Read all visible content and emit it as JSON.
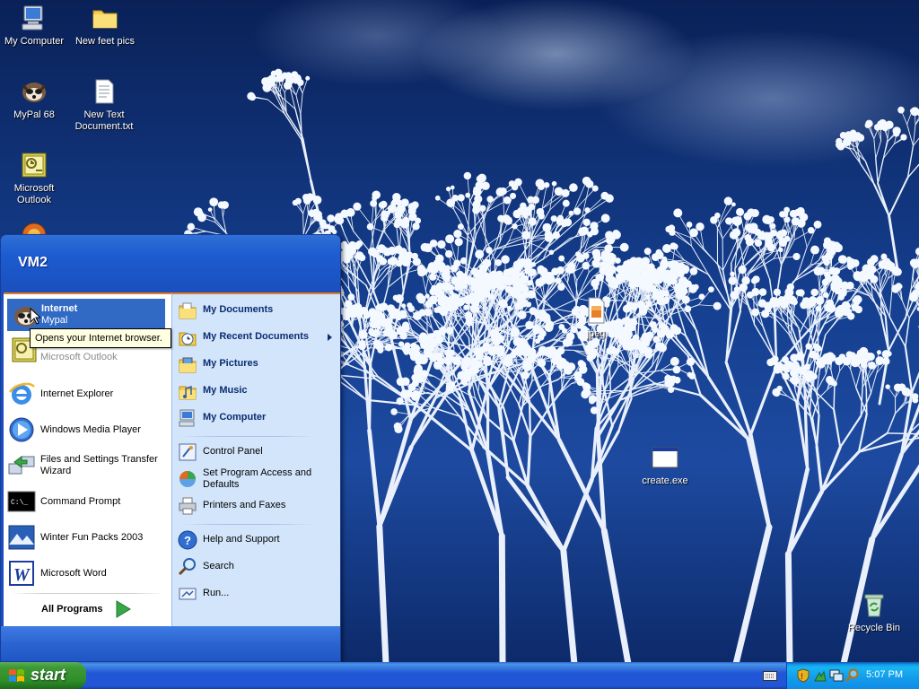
{
  "desktop": {
    "icons": [
      {
        "label": "My Computer",
        "icon": "my-computer-icon"
      },
      {
        "label": "New feet pics",
        "icon": "folder-icon"
      },
      {
        "label": "MyPal 68",
        "icon": "mypal-icon"
      },
      {
        "label": "New Text Document.txt",
        "icon": "text-document-icon"
      },
      {
        "label": "Microsoft Outlook",
        "icon": "outlook-icon"
      },
      {
        "label": "jpeg",
        "icon": "jpeg-file-icon"
      },
      {
        "label": "create.exe",
        "icon": "exe-file-icon"
      },
      {
        "label": "Recycle Bin",
        "icon": "recycle-bin-icon"
      }
    ]
  },
  "start_menu": {
    "user": "VM2",
    "left_items": [
      {
        "title": "Internet",
        "subtitle": "Mypal",
        "icon": "mypal-icon"
      },
      {
        "title": "",
        "subtitle": "Microsoft Outlook",
        "icon": "outlook-icon"
      },
      {
        "title": "Internet Explorer",
        "icon": "internet-explorer-icon"
      },
      {
        "title": "Windows Media Player",
        "icon": "media-player-icon"
      },
      {
        "title": "Files and Settings Transfer Wizard",
        "icon": "transfer-wizard-icon"
      },
      {
        "title": "Command Prompt",
        "icon": "command-prompt-icon"
      },
      {
        "title": "Winter Fun Packs 2003",
        "icon": "winter-fun-icon"
      },
      {
        "title": "Microsoft Word",
        "icon": "word-icon"
      }
    ],
    "all_programs": "All Programs",
    "right_items": [
      {
        "label": "My Documents",
        "icon": "my-documents-icon"
      },
      {
        "label": "My Recent Documents",
        "icon": "recent-documents-icon"
      },
      {
        "label": "My Pictures",
        "icon": "my-pictures-icon"
      },
      {
        "label": "My Music",
        "icon": "my-music-icon"
      },
      {
        "label": "My Computer",
        "icon": "my-computer-icon"
      },
      {
        "label": "Control Panel",
        "icon": "control-panel-icon"
      },
      {
        "label": "Set Program Access and Defaults",
        "icon": "program-access-icon"
      },
      {
        "label": "Printers and Faxes",
        "icon": "printer-icon"
      },
      {
        "label": "Help and Support",
        "icon": "help-icon"
      },
      {
        "label": "Search",
        "icon": "search-icon"
      },
      {
        "label": "Run...",
        "icon": "run-icon"
      }
    ],
    "tooltip": "Opens your Internet browser."
  },
  "taskbar": {
    "start_label": "start",
    "clock": "5:07 PM"
  }
}
